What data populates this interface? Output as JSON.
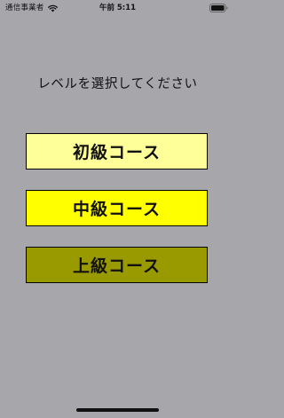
{
  "status_bar": {
    "carrier": "通信事業者",
    "time": "午前 5:11"
  },
  "main": {
    "prompt": "レベルを選択してください",
    "courses": [
      {
        "label": "初級コース",
        "color": "#ffff99"
      },
      {
        "label": "中級コース",
        "color": "#ffff00"
      },
      {
        "label": "上級コース",
        "color": "#999900"
      }
    ]
  },
  "icons": [
    "wifi-icon",
    "battery-icon"
  ]
}
